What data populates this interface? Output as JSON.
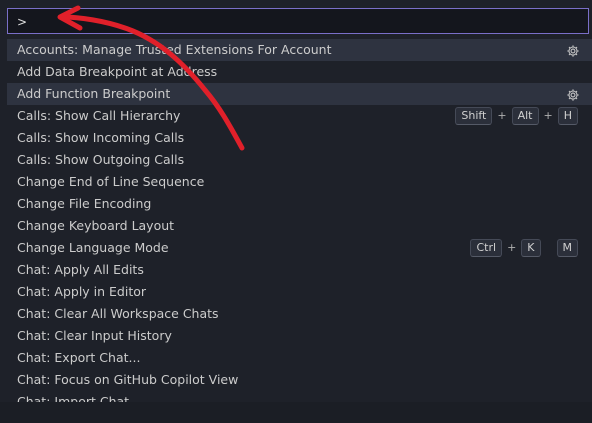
{
  "input": {
    "value": ">"
  },
  "commands": [
    {
      "label": "Accounts: Manage Trusted Extensions For Account",
      "highlighted": true,
      "gear": true
    },
    {
      "label": "Add Data Breakpoint at Address"
    },
    {
      "label": "Add Function Breakpoint",
      "highlighted": true,
      "gear": true
    },
    {
      "label": "Calls: Show Call Hierarchy",
      "keys": [
        "Shift",
        "+",
        "Alt",
        "+",
        "H"
      ]
    },
    {
      "label": "Calls: Show Incoming Calls"
    },
    {
      "label": "Calls: Show Outgoing Calls"
    },
    {
      "label": "Change End of Line Sequence"
    },
    {
      "label": "Change File Encoding"
    },
    {
      "label": "Change Keyboard Layout"
    },
    {
      "label": "Change Language Mode",
      "keys": [
        "Ctrl",
        "+",
        "K",
        " ",
        "M"
      ]
    },
    {
      "label": "Chat: Apply All Edits"
    },
    {
      "label": "Chat: Apply in Editor"
    },
    {
      "label": "Chat: Clear All Workspace Chats"
    },
    {
      "label": "Chat: Clear Input History"
    },
    {
      "label": "Chat: Export Chat..."
    },
    {
      "label": "Chat: Focus on GitHub Copilot View"
    },
    {
      "label": "Chat: Import Chat..."
    }
  ],
  "colors": {
    "annotation_arrow": "#e0202a",
    "focus_border": "#7a6fc8"
  },
  "icons": {
    "row_action": "gear-icon"
  }
}
